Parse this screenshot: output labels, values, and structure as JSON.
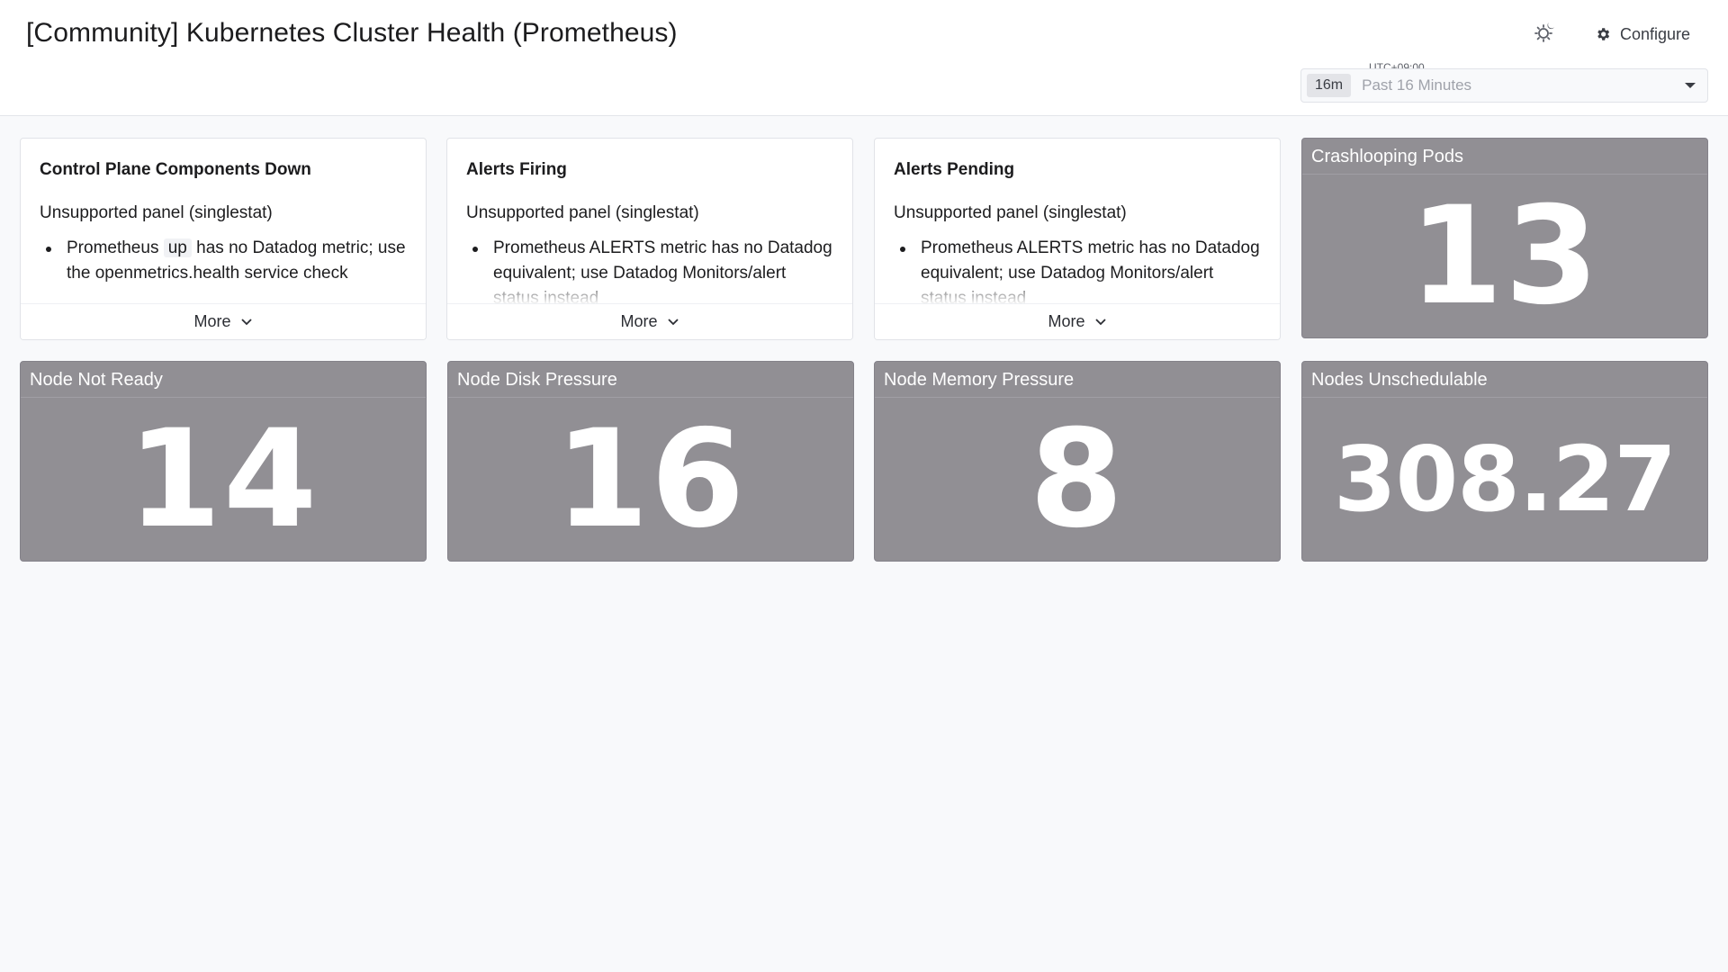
{
  "header": {
    "title": "[Community] Kubernetes Cluster Health (Prometheus)",
    "configure_label": "Configure",
    "timezone": "UTC+09:00",
    "time_badge": "16m",
    "time_range": "Past 16 Minutes"
  },
  "unsupported_cards": [
    {
      "title": "Control Plane Components Down",
      "subtitle": "Unsupported panel (singlestat)",
      "bullet_pre": "Prometheus",
      "bullet_code": "up",
      "bullet_post": "has no Datadog metric; use the openmetrics.health service check",
      "more_label": "More"
    },
    {
      "title": "Alerts Firing",
      "subtitle": "Unsupported panel (singlestat)",
      "bullet": "Prometheus ALERTS metric has no Datadog equivalent; use Datadog Monitors/alert status instead",
      "more_label": "More"
    },
    {
      "title": "Alerts Pending",
      "subtitle": "Unsupported panel (singlestat)",
      "bullet": "Prometheus ALERTS metric has no Datadog equivalent; use Datadog Monitors/alert status instead",
      "more_label": "More"
    }
  ],
  "stats": [
    {
      "title": "Crashlooping Pods",
      "value": "13"
    },
    {
      "title": "Node Not Ready",
      "value": "14"
    },
    {
      "title": "Node Disk Pressure",
      "value": "16"
    },
    {
      "title": "Node Memory Pressure",
      "value": "8"
    },
    {
      "title": "Nodes Unschedulable",
      "value": "308.27"
    }
  ],
  "colors": {
    "stat_background": "#918f94",
    "page_background": "#f8f9fb"
  },
  "icons": {
    "theme": "sun-moon-icon",
    "configure": "gear-icon",
    "time_caret": "caret-down-icon",
    "more_chevron": "chevron-down-icon"
  }
}
